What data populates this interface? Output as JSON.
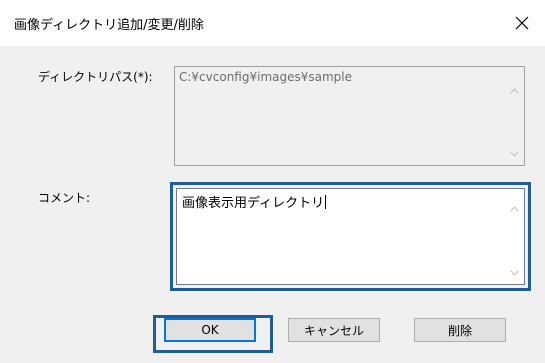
{
  "dialog": {
    "title": "画像ディレクトリ追加/変更/削除",
    "close_icon": "close-icon"
  },
  "directory": {
    "label": "ディレクトリパス(*):",
    "value": "C:¥cvconfig¥images¥sample"
  },
  "comment": {
    "label": "コメント:",
    "value": "画像表示用ディレクトリ"
  },
  "buttons": {
    "ok": "OK",
    "cancel": "キャンセル",
    "delete": "削除"
  },
  "colors": {
    "highlight": "#1f5c99",
    "dialog_bg": "#f0f0f0"
  }
}
